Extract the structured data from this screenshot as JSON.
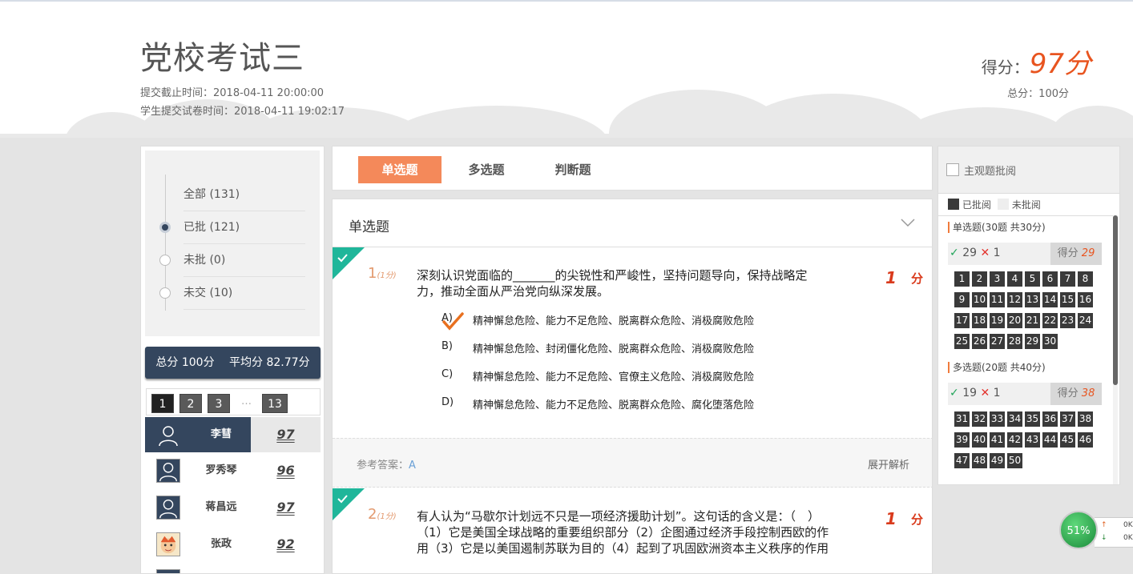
{
  "header": {
    "title": "党校考试三",
    "deadline": "提交截止时间：2018-04-11 20:00:00",
    "submitted": "学生提交试卷时间：2018-04-11 19:02:17",
    "score_label": "得分：",
    "score_value": "97分",
    "total": "总分：100分"
  },
  "filters": [
    {
      "label": "全部 (131)"
    },
    {
      "label": "已批 (121)"
    },
    {
      "label": "未批 (0)"
    },
    {
      "label": "未交 (10)"
    }
  ],
  "summary": "总分 100分　 平均分 82.77分",
  "pager": {
    "p1": "1",
    "p2": "2",
    "p3": "3",
    "dots": "…",
    "last": "13"
  },
  "students": [
    {
      "name": "李彗",
      "score": "97"
    },
    {
      "name": "罗秀琴",
      "score": "96"
    },
    {
      "name": "蒋昌远",
      "score": "97"
    },
    {
      "name": "张政",
      "score": "92"
    }
  ],
  "tabs": [
    "单选题",
    "多选题",
    "判断题"
  ],
  "section_title": "单选题",
  "questions": [
    {
      "num": "1",
      "pts": "(1分)",
      "text": "深刻认识党面临的_______的尖锐性和严峻性，坚持问题导向，保持战略定力，推动全面从严治党向纵深发展。",
      "score": "1",
      "fen": "分",
      "options": [
        {
          "letter": "A)",
          "text": "精神懈怠危险、能力不足危险、脱离群众危险、消极腐败危险"
        },
        {
          "letter": "B)",
          "text": "精神懈怠危险、封闭僵化危险、脱离群众危险、消极腐败危险"
        },
        {
          "letter": "C)",
          "text": "精神懈怠危险、能力不足危险、官僚主义危险、消极腐败危险"
        },
        {
          "letter": "D)",
          "text": "精神懈怠危险、能力不足危险、脱离群众危险、腐化堕落危险"
        }
      ],
      "ref_label": "参考答案：",
      "ref_answer": "A",
      "expand": "展开解析"
    },
    {
      "num": "2",
      "pts": "(1分)",
      "text": "有人认为“马歇尔计划远不只是一项经济援助计划”。这句话的含义是：（　）（1）它是美国全球战略的重要组织部分（2）企图通过经济手段控制西欧的作用（3）它是以美国遏制苏联为目的（4）起到了巩固欧洲资本主义秩序的作用",
      "score": "1",
      "fen": "分"
    }
  ],
  "review": {
    "title": "主观题批阅",
    "legend_done": "已批阅",
    "legend_todo": "未批阅",
    "sections": [
      {
        "head": "单选题(30题 共30分)",
        "right": "29",
        "wrong": "1",
        "score_label": "得分",
        "score": "29",
        "cells": [
          "1",
          "2",
          "3",
          "4",
          "5",
          "6",
          "7",
          "8",
          "9",
          "10",
          "11",
          "12",
          "13",
          "14",
          "15",
          "16",
          "17",
          "18",
          "19",
          "20",
          "21",
          "22",
          "23",
          "24",
          "25",
          "26",
          "27",
          "28",
          "29",
          "30"
        ]
      },
      {
        "head": "多选题(20题 共40分)",
        "right": "19",
        "wrong": "1",
        "score_label": "得分",
        "score": "38",
        "cells": [
          "31",
          "32",
          "33",
          "34",
          "35",
          "36",
          "37",
          "38",
          "39",
          "40",
          "41",
          "42",
          "43",
          "44",
          "45",
          "46",
          "47",
          "48",
          "49",
          "50"
        ]
      }
    ]
  },
  "net": {
    "percent": "51%",
    "up": "0K",
    "down": "0K"
  },
  "colors": {
    "accent": "#f4895a",
    "navy": "#34465e",
    "score_red": "#e8541f",
    "correct_green": "#22a55a"
  }
}
